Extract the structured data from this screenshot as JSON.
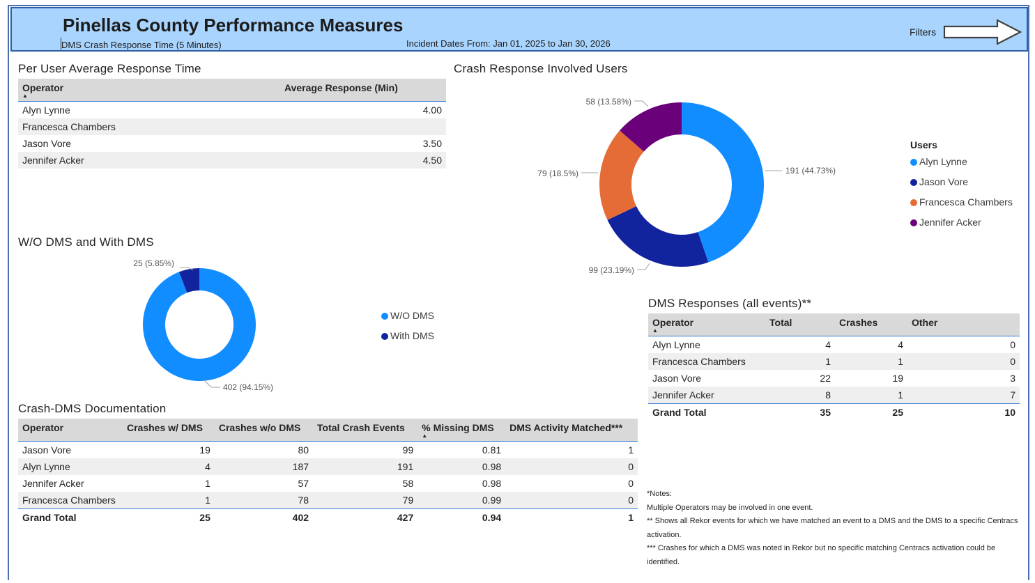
{
  "header": {
    "title": "Pinellas County Performance Measures",
    "subtitle": "DMS Crash Response Time (5 Minutes)",
    "date_range": "Incident Dates From: Jan 01, 2025 to Jan 30, 2026",
    "filters_label": "Filters",
    "background_color": "#a9d4fd"
  },
  "avg_response": {
    "title": "Per User Average Response Time",
    "columns": [
      "Operator",
      "Average Response (Min)"
    ],
    "rows": [
      [
        "Alyn Lynne",
        "4.00"
      ],
      [
        "Francesca Chambers",
        ""
      ],
      [
        "Jason Vore",
        "3.50"
      ],
      [
        "Jennifer Acker",
        "4.50"
      ]
    ]
  },
  "dms_split": {
    "title": "W/O DMS and With DMS",
    "legend": [
      "W/O DMS",
      "With DMS"
    ],
    "labels": [
      "402 (94.15%)",
      "25 (5.85%)"
    ]
  },
  "users_donut": {
    "title": "Crash Response Involved Users",
    "legend_title": "Users",
    "legend": [
      "Alyn Lynne",
      "Jason Vore",
      "Francesca Chambers",
      "Jennifer Acker"
    ],
    "labels": [
      "191 (44.73%)",
      "99 (23.19%)",
      "79 (18.5%)",
      "58 (13.58%)"
    ]
  },
  "documentation": {
    "title": "Crash-DMS Documentation",
    "columns": [
      "Operator",
      "Crashes w/ DMS",
      "Crashes w/o DMS",
      "Total Crash Events",
      "% Missing DMS",
      "DMS Activity Matched***"
    ],
    "rows": [
      [
        "Jason Vore",
        "19",
        "80",
        "99",
        "0.81",
        "1"
      ],
      [
        "Alyn Lynne",
        "4",
        "187",
        "191",
        "0.98",
        "0"
      ],
      [
        "Jennifer Acker",
        "1",
        "57",
        "58",
        "0.98",
        "0"
      ],
      [
        "Francesca Chambers",
        "1",
        "78",
        "79",
        "0.99",
        "0"
      ]
    ],
    "total": [
      "Grand Total",
      "25",
      "402",
      "427",
      "0.94",
      "1"
    ]
  },
  "dms_responses": {
    "title": "DMS Responses (all events)**",
    "columns": [
      "Operator",
      "Total",
      "Crashes",
      "Other"
    ],
    "rows": [
      [
        "Alyn Lynne",
        "4",
        "4",
        "0"
      ],
      [
        "Francesca Chambers",
        "1",
        "1",
        "0"
      ],
      [
        "Jason Vore",
        "22",
        "19",
        "3"
      ],
      [
        "Jennifer Acker",
        "8",
        "1",
        "7"
      ]
    ],
    "total": [
      "Grand Total",
      "35",
      "25",
      "10"
    ]
  },
  "notes": [
    "*Notes:",
    "Multiple Operators may be involved in one event.",
    "** Shows all Rekor events for which we have matched an event to a DMS and the DMS to a specific Centracs activation.",
    "*** Crashes for which a DMS was noted in Rekor but no specific matching Centracs activation could be identified."
  ],
  "chart_data": [
    {
      "type": "pie",
      "title": "W/O DMS and With DMS",
      "categories": [
        "W/O DMS",
        "With DMS"
      ],
      "values": [
        402,
        25
      ],
      "percentages": [
        94.15,
        5.85
      ],
      "colors": [
        "#118dff",
        "#12239e"
      ],
      "legend_position": "right"
    },
    {
      "type": "pie",
      "title": "Crash Response Involved Users",
      "categories": [
        "Alyn Lynne",
        "Jason Vore",
        "Francesca Chambers",
        "Jennifer Acker"
      ],
      "values": [
        191,
        99,
        79,
        58
      ],
      "percentages": [
        44.73,
        23.19,
        18.5,
        13.58
      ],
      "colors": [
        "#118dff",
        "#12239e",
        "#e66c37",
        "#6b007b"
      ],
      "legend_position": "right"
    }
  ]
}
